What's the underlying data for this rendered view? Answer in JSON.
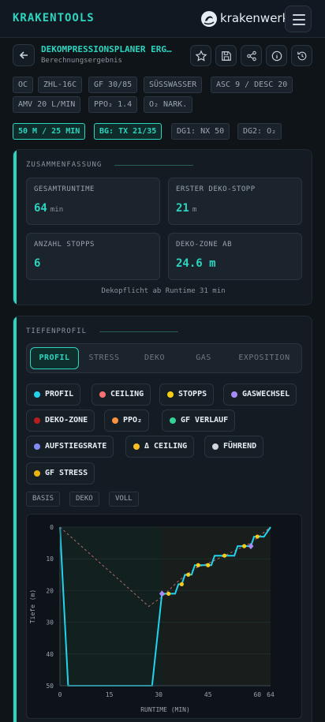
{
  "header": {
    "brand": "KRAKENTOOLS",
    "logo_text": "krakenwerk"
  },
  "page": {
    "title": "DEKOMPRESSIONSPLANER ERG…",
    "subtitle": "Berechnungsergebnis"
  },
  "params": [
    "OC",
    "ZHL-16C",
    "GF 30/85",
    "SÜSSWASSER",
    "ASC 9 / DESC 20",
    "AMV 20 L/MIN",
    "PPO₂ 1.4",
    "O₂ NARK."
  ],
  "gas_chips": [
    "50 M / 25 MIN",
    "BG: TX 21/35",
    "DG1: NX 50",
    "DG2: O₂"
  ],
  "summary": {
    "title": "ZUSAMMENFASSUNG",
    "stats": [
      {
        "label": "GESAMTRUNTIME",
        "value": "64",
        "unit": "min"
      },
      {
        "label": "ERSTER DEKO-STOPP",
        "value": "21",
        "unit": "m"
      },
      {
        "label": "ANZAHL STOPPS",
        "value": "6",
        "unit": ""
      },
      {
        "label": "DEKO-ZONE AB",
        "value": "24.6 m",
        "unit": ""
      }
    ],
    "note": "Dekopflicht ab Runtime 31 min"
  },
  "profile": {
    "title": "TIEFENPROFIL",
    "tabs": [
      "PROFIL",
      "STRESS",
      "DEKO",
      "GAS",
      "EXPOSITION"
    ],
    "active_tab": "PROFIL",
    "legend": [
      {
        "label": "PROFIL",
        "color": "#22d3ee"
      },
      {
        "label": "CEILING",
        "color": "#f87171"
      },
      {
        "label": "STOPPS",
        "color": "#facc15"
      },
      {
        "label": "GASWECHSEL",
        "color": "#a78bfa"
      },
      {
        "label": "DEKO-ZONE",
        "color": "#b91c1c"
      },
      {
        "label": "PPO₂",
        "color": "#fb923c"
      },
      {
        "label": "GF VERLAUF",
        "color": "#34d399"
      },
      {
        "label": "AUFSTIEGSRATE",
        "color": "#818cf8"
      },
      {
        "label": "Δ CEILING",
        "color": "#fbbf24"
      },
      {
        "label": "FÜHREND",
        "color": "#d1d5db"
      },
      {
        "label": "GF STRESS",
        "color": "#eab308"
      }
    ],
    "views": [
      "BASIS",
      "DEKO",
      "VOLL"
    ],
    "chart_data": {
      "type": "line",
      "xlabel": "RUNTIME (MIN)",
      "ylabel": "Tiefe (m)",
      "xlim": [
        0,
        64
      ],
      "ylim": [
        50,
        0
      ],
      "x_ticks": [
        0,
        15,
        30,
        45,
        60,
        64
      ],
      "y_ticks": [
        0,
        10,
        20,
        30,
        40,
        50
      ],
      "profile": [
        [
          0,
          0
        ],
        [
          2.5,
          50
        ],
        [
          28,
          50
        ],
        [
          31,
          21
        ],
        [
          33,
          21
        ],
        [
          35,
          21
        ],
        [
          36,
          18
        ],
        [
          37,
          18
        ],
        [
          38,
          15
        ],
        [
          40,
          15
        ],
        [
          41,
          12
        ],
        [
          45,
          12
        ],
        [
          46,
          12
        ],
        [
          47,
          9
        ],
        [
          53,
          9
        ],
        [
          54,
          6
        ],
        [
          58,
          6
        ],
        [
          59,
          3
        ],
        [
          62,
          3
        ],
        [
          64,
          0
        ]
      ],
      "stops": [
        [
          33,
          21
        ],
        [
          37,
          18
        ],
        [
          39,
          15
        ],
        [
          42,
          12
        ],
        [
          45,
          12
        ],
        [
          50,
          9
        ],
        [
          56,
          6
        ],
        [
          60,
          3
        ]
      ],
      "gas_switches": [
        [
          31,
          21
        ],
        [
          58,
          6
        ]
      ],
      "ceiling": [
        [
          0,
          0
        ],
        [
          27,
          25
        ],
        [
          31,
          22
        ],
        [
          36,
          17
        ],
        [
          41,
          13
        ],
        [
          46,
          11
        ],
        [
          52,
          8
        ],
        [
          58,
          5
        ],
        [
          64,
          0
        ]
      ]
    }
  }
}
